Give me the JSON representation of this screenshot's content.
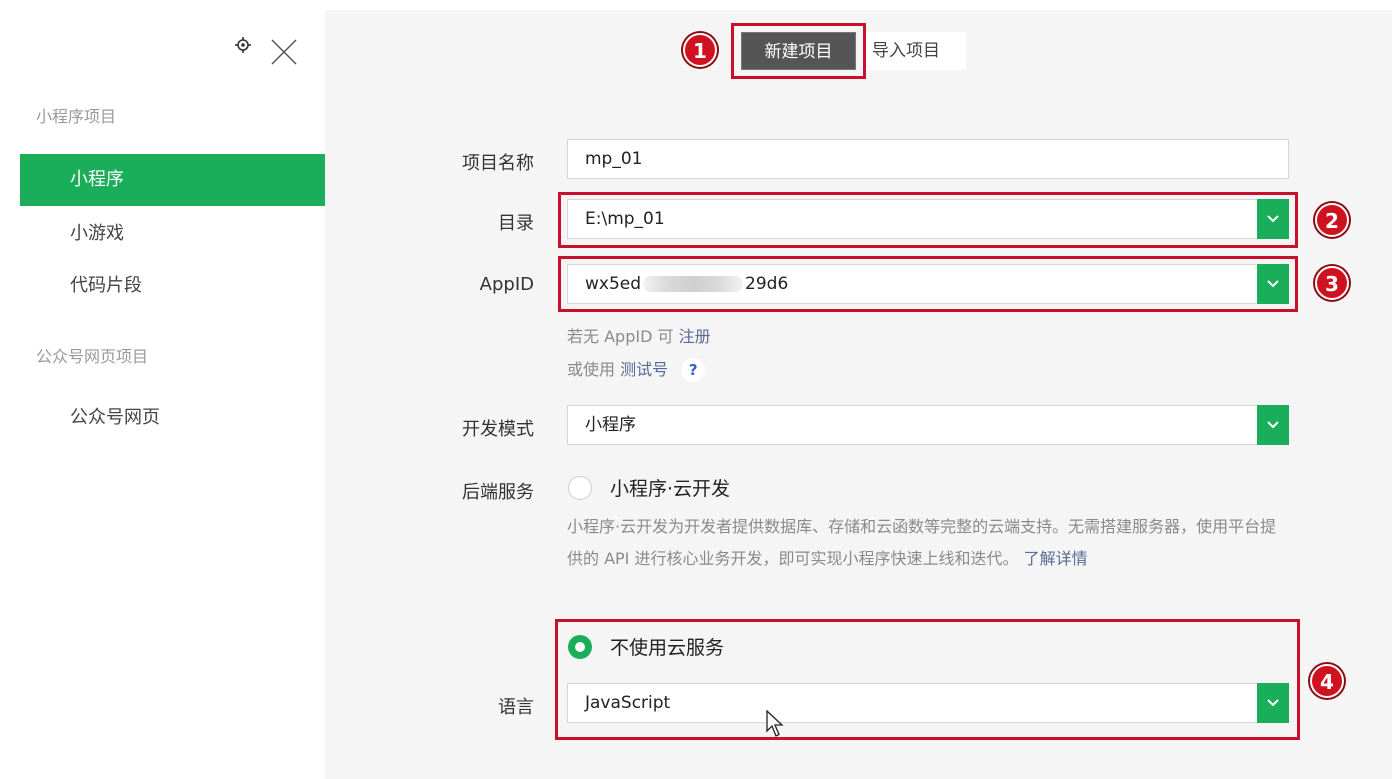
{
  "sidebar": {
    "sections": [
      {
        "title": "小程序项目",
        "items": [
          "小程序",
          "小游戏",
          "代码片段"
        ]
      },
      {
        "title": "公众号网页项目",
        "items": [
          "公众号网页"
        ]
      }
    ],
    "active_item": "小程序"
  },
  "tabs": {
    "new_project": "新建项目",
    "import_project": "导入项目"
  },
  "form": {
    "project_name": {
      "label": "项目名称",
      "value": "mp_01"
    },
    "directory": {
      "label": "目录",
      "value": "E:\\mp_01"
    },
    "appid": {
      "label": "AppID",
      "value_start": "wx5ed",
      "value_end": "29d6"
    },
    "appid_hint": {
      "line1_prefix": "若无 AppID 可",
      "register_link": "注册",
      "line2_prefix": "或使用",
      "test_link": "测试号",
      "help": "?"
    },
    "dev_mode": {
      "label": "开发模式",
      "value": "小程序"
    },
    "backend": {
      "label": "后端服务",
      "cloud_option": "小程序·云开发",
      "description": "小程序·云开发为开发者提供数据库、存储和云函数等完整的云端支持。无需搭建服务器，使用平台提供的 API 进行核心业务开发，即可实现小程序快速上线和迭代。",
      "learn_more": "了解详情",
      "no_cloud_option": "不使用云服务",
      "selected": "不使用云服务"
    },
    "language": {
      "label": "语言",
      "value": "JavaScript"
    }
  },
  "annotations": [
    "1",
    "2",
    "3",
    "4"
  ],
  "colors": {
    "accent": "#1aad5a",
    "annotation": "#c8102e",
    "link": "#576b95"
  }
}
